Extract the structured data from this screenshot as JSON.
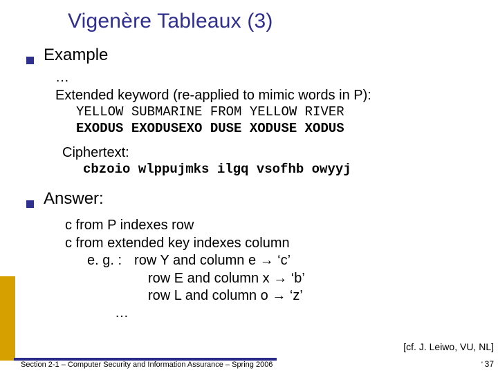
{
  "title": "Vigenère Tableaux (3)",
  "example": {
    "heading": "Example",
    "ellipsis": "…",
    "extended_label": "Extended keyword (re-applied to mimic words in P):",
    "plain_line": "YELLOW SUBMARINE FROM YELLOW RIVER",
    "key_line": "EXODUS EXODUSEXO DUSE XODUSE XODUS",
    "ciphertext_label": "Ciphertext:",
    "ciphertext": "cbzoio wlppujmks ilgq vsofhb owyyj"
  },
  "answer": {
    "heading": "Answer:",
    "line1": "c from P indexes row",
    "line2": "c from extended key indexes column",
    "eg_label": "e. g. :",
    "eg1": "row Y and column e → ‘c’",
    "eg2": "row E and column x → ‘b’",
    "eg3": "row L and column o → ‘z’",
    "trailing": "…"
  },
  "citation": "[cf. J. Leiwo, VU, NL]",
  "footer": "Section 2-1 – Computer Security and Information Assurance – Spring 2006",
  "page_number": "37",
  "small_mark": "'"
}
